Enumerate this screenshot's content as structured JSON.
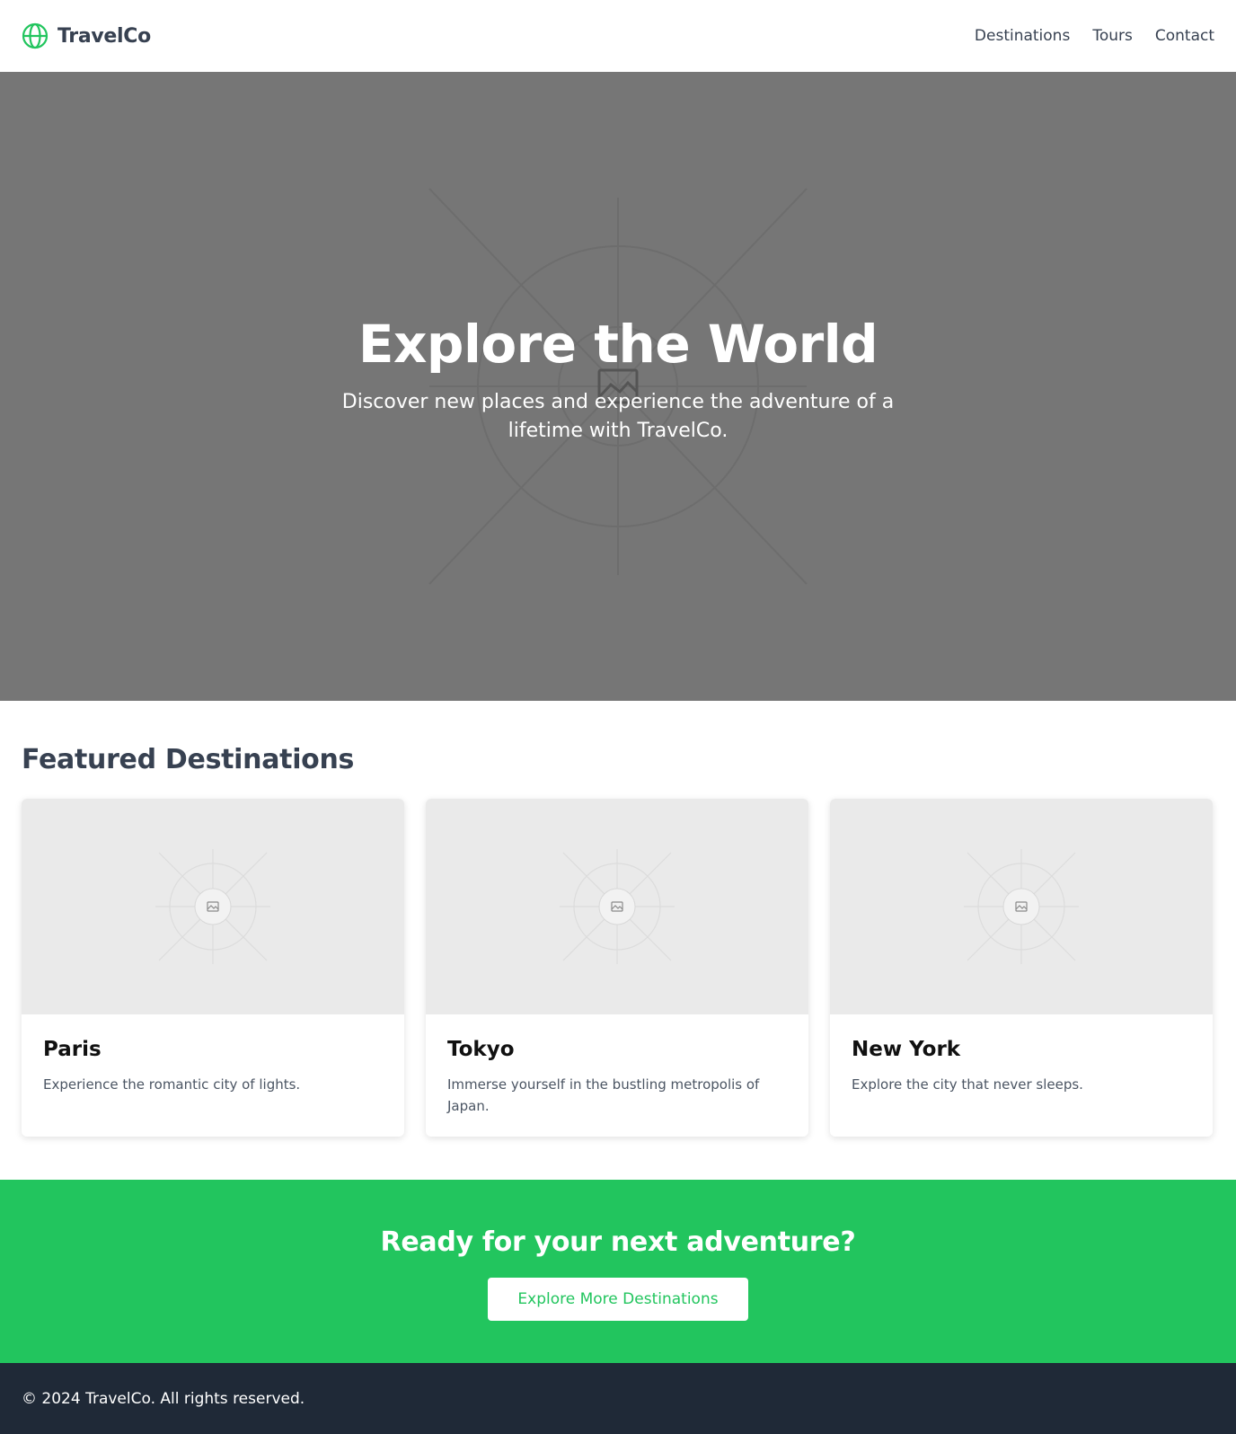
{
  "header": {
    "logo_icon": "globe-icon",
    "brand": "TravelCo",
    "nav": [
      {
        "label": "Destinations"
      },
      {
        "label": "Tours"
      },
      {
        "label": "Contact"
      }
    ]
  },
  "hero": {
    "title": "Explore the World",
    "subtitle": "Discover new places and experience the adventure of a lifetime with TravelCo.",
    "image_icon": "image-placeholder-icon"
  },
  "featured": {
    "title": "Featured Destinations",
    "cards": [
      {
        "title": "Paris",
        "description": "Experience the romantic city of lights.",
        "image_icon": "image-placeholder-icon"
      },
      {
        "title": "Tokyo",
        "description": "Immerse yourself in the bustling metropolis of Japan.",
        "image_icon": "image-placeholder-icon"
      },
      {
        "title": "New York",
        "description": "Explore the city that never sleeps.",
        "image_icon": "image-placeholder-icon"
      }
    ]
  },
  "cta": {
    "title": "Ready for your next adventure?",
    "button": "Explore More Destinations"
  },
  "footer": {
    "text": "© 2024 TravelCo. All rights reserved."
  },
  "colors": {
    "accent": "#22c55e",
    "text": "#374151",
    "footer_bg": "#1f2937",
    "hero_bg": "#767676",
    "card_image_bg": "#eaeaea"
  }
}
